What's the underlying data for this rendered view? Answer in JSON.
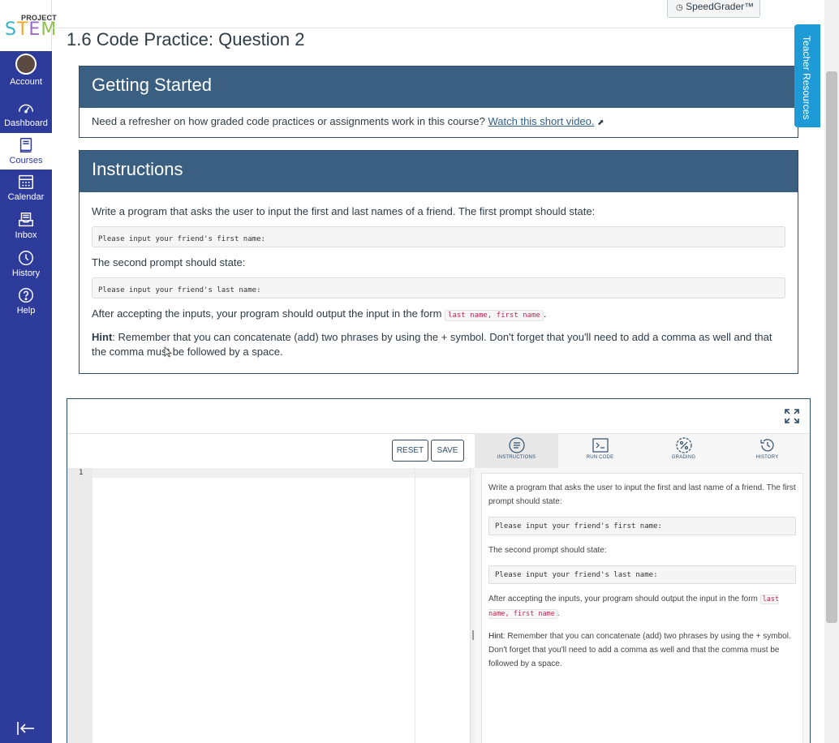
{
  "nav": {
    "logo_project": "PROJECT",
    "logo_stem": "STEM",
    "items": [
      {
        "label": "Account"
      },
      {
        "label": "Dashboard"
      },
      {
        "label": "Courses"
      },
      {
        "label": "Calendar"
      },
      {
        "label": "Inbox"
      },
      {
        "label": "History"
      },
      {
        "label": "Help"
      }
    ]
  },
  "header": {
    "speedgrader_label": "SpeedGrader™",
    "page_title": "1.6 Code Practice: Question 2",
    "teacher_resources": "Teacher Resources"
  },
  "getting_started": {
    "title": "Getting Started",
    "text": "Need a refresher on how graded code practices or assignments work in this course?",
    "link": "Watch this short video."
  },
  "instructions": {
    "title": "Instructions",
    "p1": "Write a program that asks the user to input the first and last names of a friend. The first prompt should state:",
    "code1": "Please input your friend's first name:",
    "p2": "The second prompt should state:",
    "code2": "Please input your friend's last name:",
    "p3_before": "After accepting the inputs, your program should output the input in the form",
    "p3_code": "last name, first name",
    "p3_after": ".",
    "hint_label": "Hint",
    "hint_text": ": Remember that you can concatenate (add) two phrases by using the + symbol.  Don't forget that you'll need to add a comma as well and that the comma must be followed by a space."
  },
  "ide": {
    "reset_label": "RESET",
    "save_label": "SAVE",
    "line_number": "1",
    "tabs": [
      {
        "label": "INSTRUCTIONS"
      },
      {
        "label": "RUN CODE"
      },
      {
        "label": "GRADING"
      },
      {
        "label": "HISTORY"
      }
    ],
    "side": {
      "p1": "Write a program that asks the user to input the first and last name of a friend. The first prompt should state:",
      "code1": "Please input your friend's first name:",
      "p2": "The second prompt should state:",
      "code2": "Please input your friend's last name:",
      "p3_before": "After accepting the inputs, your program should output the input in the form",
      "p3_code": "last name, first name",
      "p3_after": ".",
      "hint_label": "Hint",
      "hint_text": ": Remember that you can concatenate (add) two phrases by using the + symbol. Don't forget that you'll need to add a comma as well and that the comma must be followed by a space."
    }
  },
  "colors": {
    "nav_bg": "#2d3b9b",
    "panel_header": "#3b5f80",
    "teacher_tab": "#1e9bd7",
    "code_red": "#c7254e"
  }
}
